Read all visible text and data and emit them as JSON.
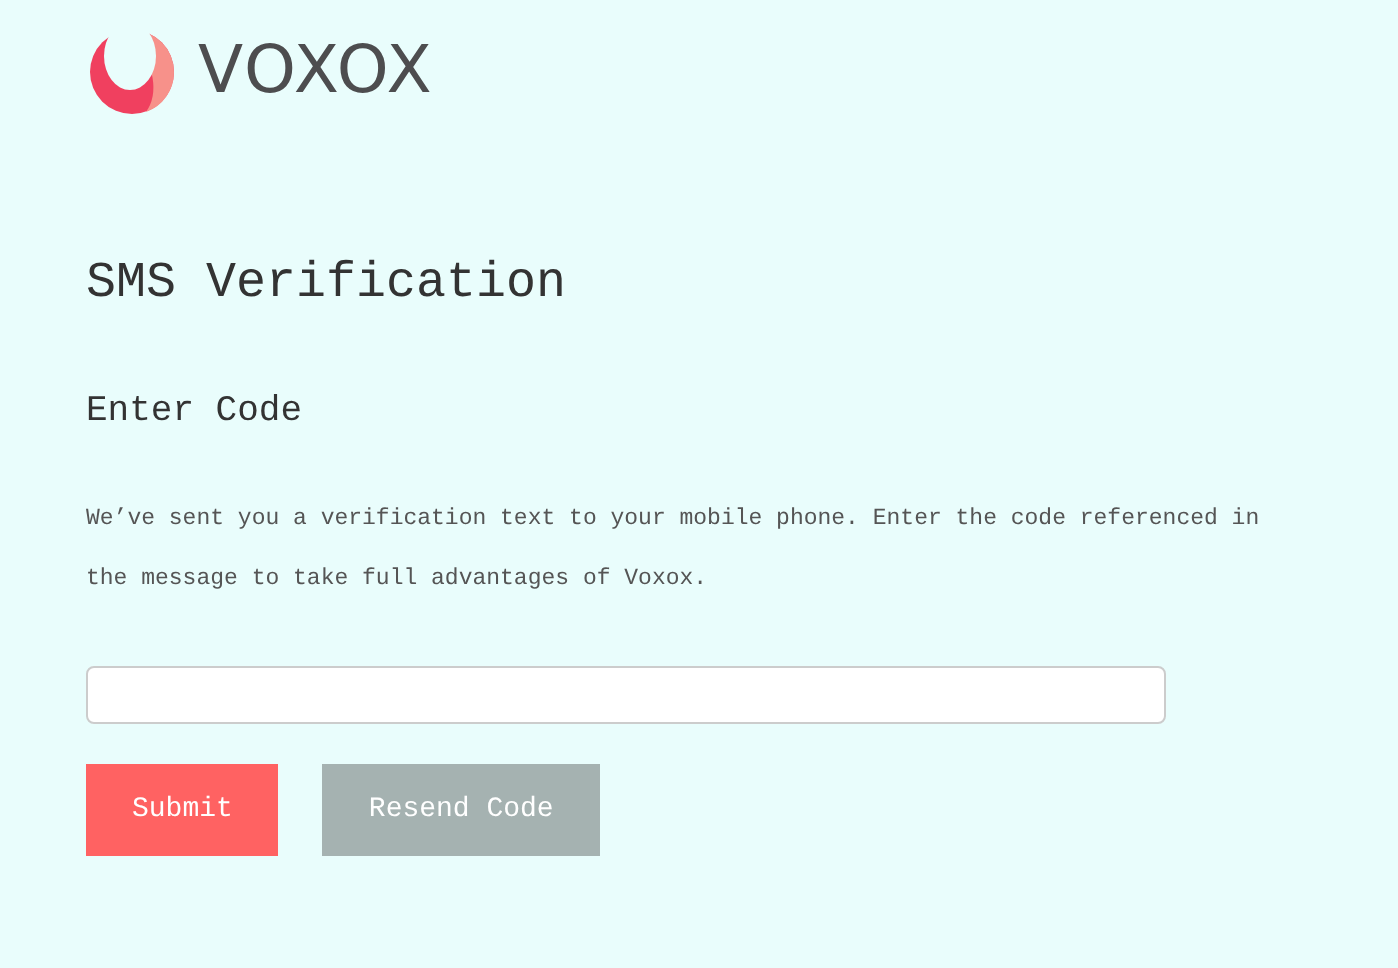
{
  "logo": {
    "text": "VOXOX"
  },
  "title": "SMS Verification",
  "subtitle": "Enter Code",
  "message": "We’ve sent you a verification text to your mobile phone. Enter the code referenced in the message to take full advantages of Voxox.",
  "buttons": [
    {
      "label": "Submit",
      "kind": "primary"
    },
    {
      "label": "Resend Code",
      "kind": "secondary"
    }
  ]
}
